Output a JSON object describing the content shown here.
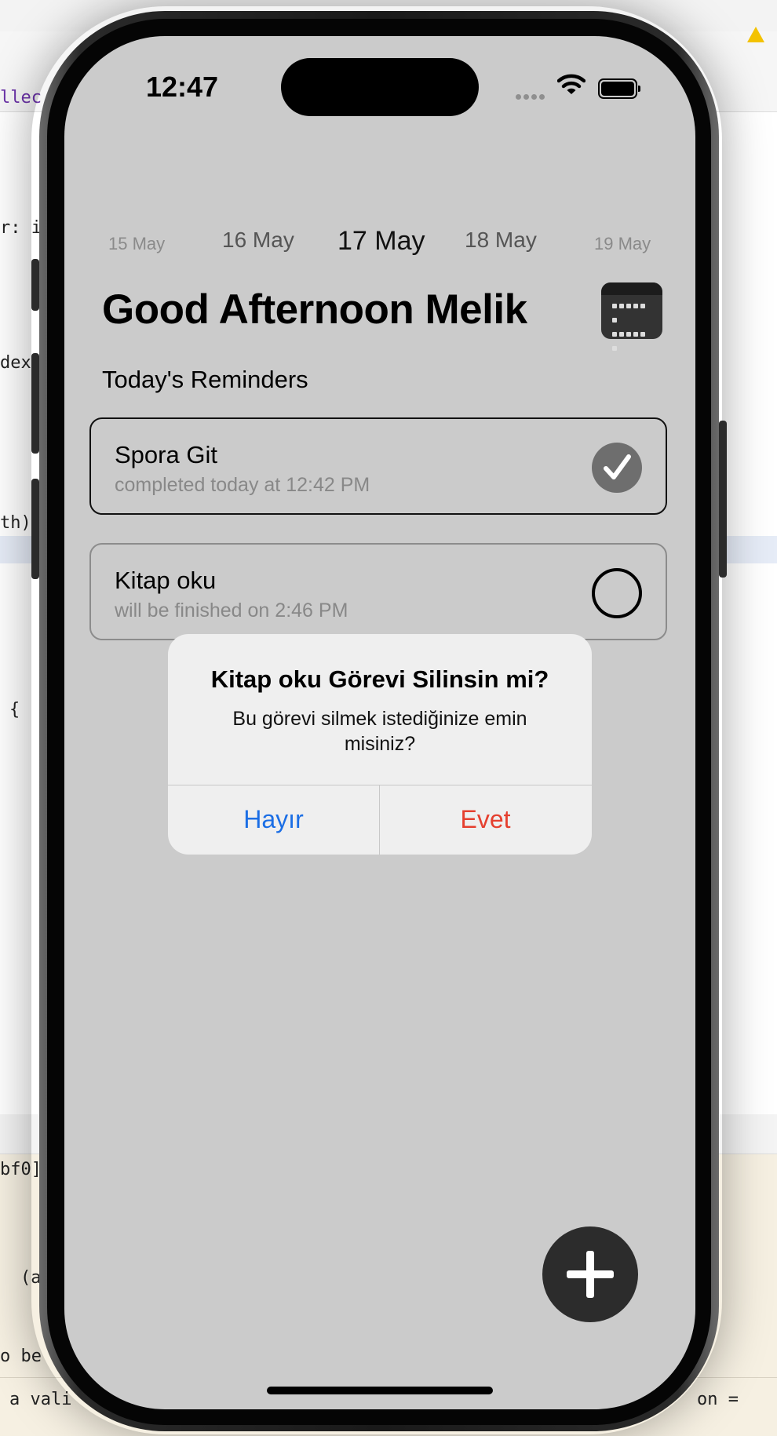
{
  "background": {
    "code_fragments": [
      "llec",
      "r: i",
      "dex",
      "th)",
      "{",
      "bf0]",
      "(a",
      "o be",
      "a vali",
      "on ="
    ]
  },
  "status_bar": {
    "time": "12:47"
  },
  "date_strip": {
    "dates": [
      "15 May",
      "16 May",
      "17 May",
      "18 May",
      "19 May"
    ],
    "selected": "17 May"
  },
  "header": {
    "greeting": "Good Afternoon Melik",
    "calendar_icon": "calendar-icon"
  },
  "reminders": {
    "section_title": "Today's Reminders",
    "items": [
      {
        "title": "Spora Git",
        "subtitle": "completed today at 12:42 PM",
        "done": true
      },
      {
        "title": "Kitap oku",
        "subtitle": "will be finished on 2:46 PM",
        "done": false
      }
    ]
  },
  "alert": {
    "title": "Kitap oku Görevi Silinsin mi?",
    "message": "Bu görevi silmek istediğinize emin misiniz?",
    "cancel_label": "Hayır",
    "confirm_label": "Evet"
  },
  "colors": {
    "screen_bg": "#cbcbcb",
    "cancel": "#1b6ee5",
    "destructive": "#e5402f",
    "fab": "#2c2c2c"
  }
}
